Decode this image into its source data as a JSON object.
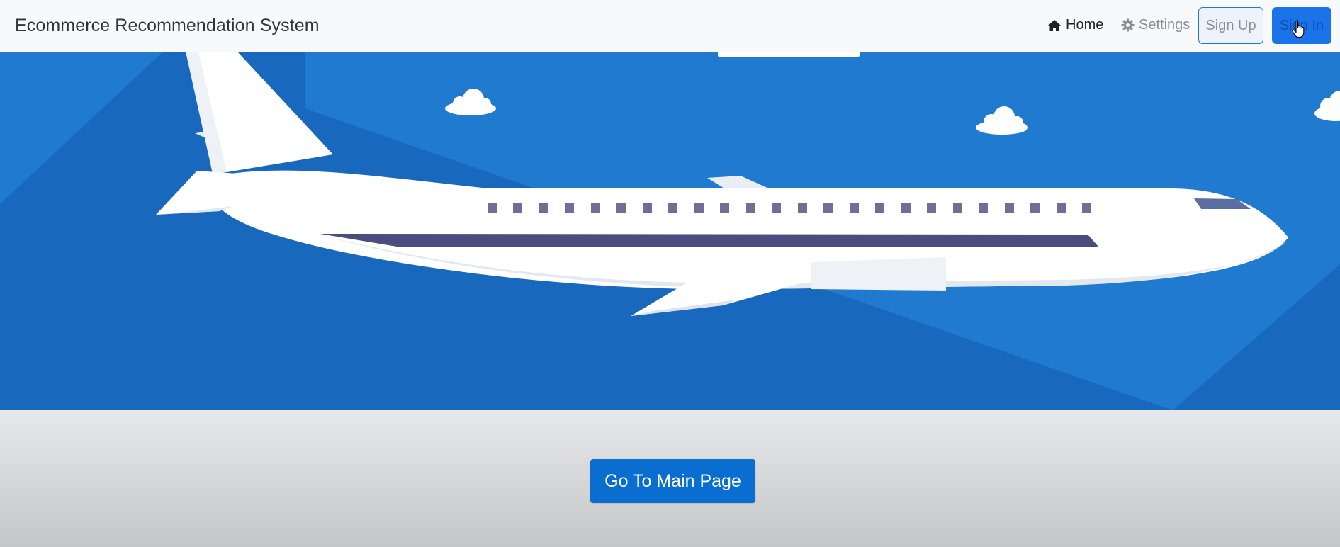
{
  "navbar": {
    "brand": "Ecommerce Recommendation System",
    "home_label": "Home",
    "settings_label": "Settings",
    "signup_label": "Sign Up",
    "signin_label": "Sign In",
    "home_icon": "home-icon",
    "settings_icon": "gear-icon"
  },
  "hero": {
    "image": "airplane-illustration",
    "sky_color": "#1f7ad0"
  },
  "main": {
    "button_label": "Go To Main Page"
  },
  "colors": {
    "primary": "#1a73e8",
    "button": "#0a6ed1"
  }
}
